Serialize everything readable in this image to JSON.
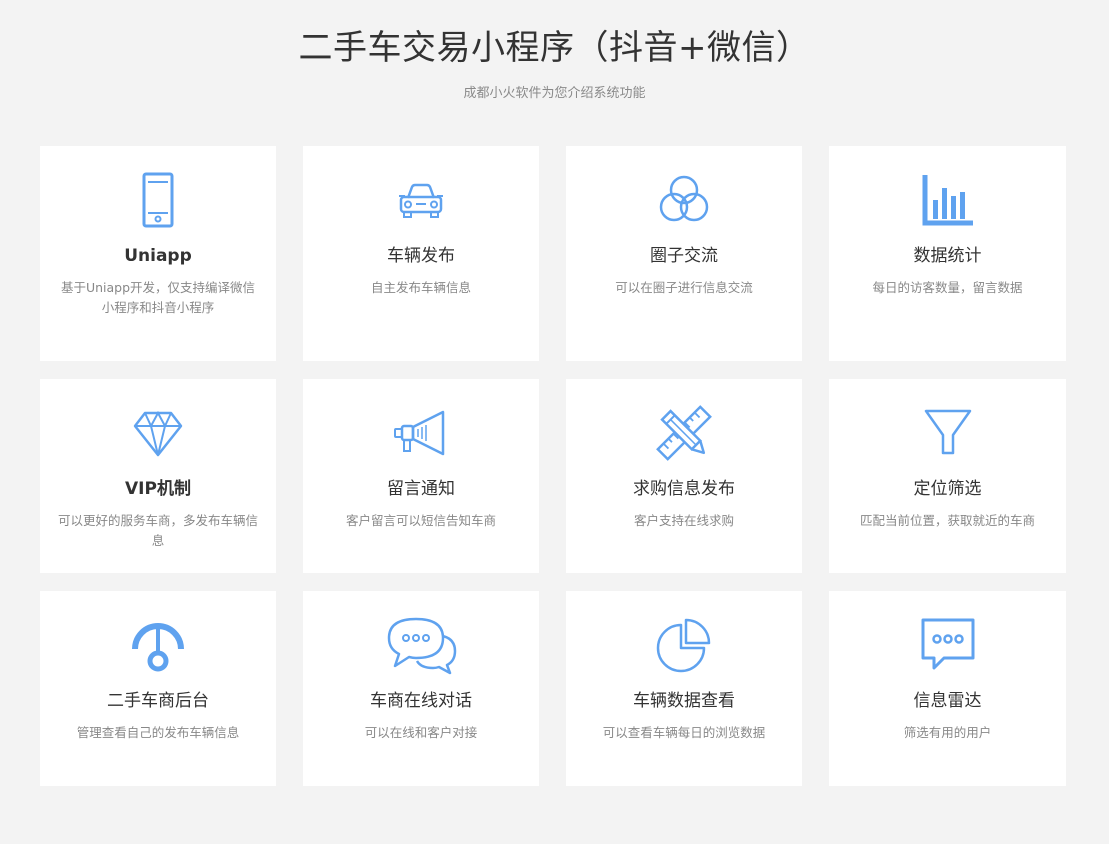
{
  "header": {
    "title": "二手车交易小程序（抖音+微信）",
    "subtitle": "成都小火软件为您介绍系统功能"
  },
  "accent_color": "#5fa2ef",
  "features": [
    {
      "icon": "phone-icon",
      "title": "Uniapp",
      "desc": "基于Uniapp开发，仅支持编译微信小程序和抖音小程序"
    },
    {
      "icon": "car-icon",
      "title": "车辆发布",
      "desc": "自主发布车辆信息"
    },
    {
      "icon": "circles-icon",
      "title": "圈子交流",
      "desc": "可以在圈子进行信息交流"
    },
    {
      "icon": "bar-chart-icon",
      "title": "数据统计",
      "desc": "每日的访客数量，留言数据"
    },
    {
      "icon": "diamond-icon",
      "title": "VIP机制",
      "desc": "可以更好的服务车商，多发布车辆信息"
    },
    {
      "icon": "megaphone-icon",
      "title": "留言通知",
      "desc": "客户留言可以短信告知车商"
    },
    {
      "icon": "ruler-pencil-icon",
      "title": "求购信息发布",
      "desc": "客户支持在线求购"
    },
    {
      "icon": "funnel-icon",
      "title": "定位筛选",
      "desc": "匹配当前位置，获取就近的车商"
    },
    {
      "icon": "gauge-icon",
      "title": "二手车商后台",
      "desc": "管理查看自己的发布车辆信息"
    },
    {
      "icon": "chat-bubbles-icon",
      "title": "车商在线对话",
      "desc": "可以在线和客户对接"
    },
    {
      "icon": "pie-chart-icon",
      "title": "车辆数据查看",
      "desc": "可以查看车辆每日的浏览数据"
    },
    {
      "icon": "message-icon",
      "title": "信息雷达",
      "desc": "筛选有用的用户"
    }
  ]
}
